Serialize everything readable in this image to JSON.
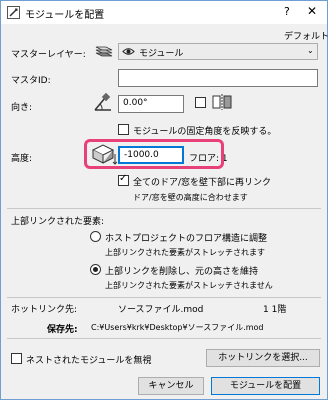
{
  "window": {
    "title": "モジュールを配置",
    "help": "?",
    "close": "✕"
  },
  "defaults_link": "デフォルト",
  "master_layer": {
    "label": "マスターレイヤー:",
    "value": "モジュール"
  },
  "master_id": {
    "label": "マスタID:",
    "value": ""
  },
  "orientation": {
    "label": "向き:",
    "angle": "0.00°",
    "mirror_checked": false
  },
  "reflect_angle": {
    "label": "モジュールの固定角度を反映する。",
    "checked": false
  },
  "elevation": {
    "label": "高度:",
    "value": "-1000.0",
    "floor_label": "フロア: 1"
  },
  "relink_doors": {
    "label": "全てのドア/窓を壁下部に再リンク",
    "checked": true,
    "note": "ドア/窓を壁の高度に合わせます"
  },
  "upper_linked": {
    "header": "上部リンクされた要素:",
    "option1": {
      "label": "ホストプロジェクトのフロア構造に調整",
      "note": "上部リンクされた要素がストレッチされます",
      "selected": false
    },
    "option2": {
      "label": "上部リンクを削除し、元の高さを維持",
      "note": "上部リンクされた要素がストレッチされません",
      "selected": true
    }
  },
  "hotlink": {
    "label": "ホットリンク先:",
    "value": "ソースファイル.mod",
    "floor": "1 1階",
    "save_label": "保存先:",
    "save_path": "C:¥Users¥krk¥Desktop¥ソースファイル.mod"
  },
  "ignore_nested": {
    "label": "ネストされたモジュールを無視",
    "checked": false
  },
  "buttons": {
    "select_hotlink": "ホットリンクを選択...",
    "cancel": "キャンセル",
    "place": "モジュールを配置"
  },
  "colors": {
    "highlight": "#e8417a",
    "primary_border": "#0078d7",
    "title_border": "#6f9fd2"
  }
}
